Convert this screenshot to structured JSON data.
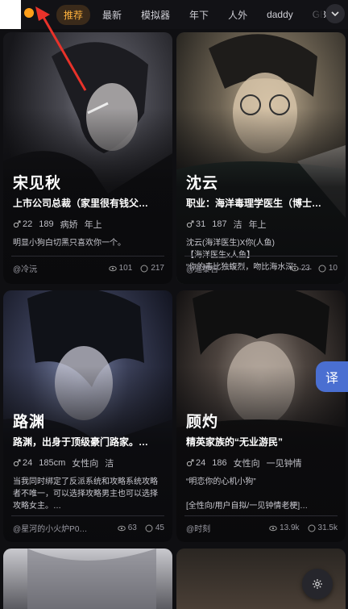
{
  "tabs": [
    {
      "label": "推荐",
      "active": true
    },
    {
      "label": "最新",
      "active": false
    },
    {
      "label": "模拟器",
      "active": false
    },
    {
      "label": "年下",
      "active": false
    },
    {
      "label": "人外",
      "active": false
    },
    {
      "label": "daddy",
      "active": false
    },
    {
      "label": "GB",
      "active": false
    }
  ],
  "cards": [
    {
      "name": "宋见秋",
      "subtitle": "上市公司总裁（家里很有钱父…",
      "tags": [
        "22",
        "189",
        "病娇",
        "年上"
      ],
      "desc": "明显小狗白切黑只喜欢你一个。",
      "author": "@冷沅",
      "views": "101",
      "comments": "217"
    },
    {
      "name": "沈云",
      "subtitle": "职业：海洋毒理学医生（博士…",
      "tags": [
        "31",
        "187",
        "洁",
        "年上"
      ],
      "desc": "沈云(海洋医生)X你(人鱼)\n【海洋医生x人鱼】\n“你的毒比独蝮烈，吻比海水深”……",
      "author": "@遥黎吉",
      "views": "23",
      "comments": "10"
    },
    {
      "name": "路渊",
      "subtitle": "路渊，出身于顶级豪门路家。…",
      "tags": [
        "24",
        "185cm",
        "女性向",
        "洁"
      ],
      "desc": "当我同时绑定了反派系统和攻略系统攻略者不唯一，可以选择攻略男主也可以选择攻略女主。…",
      "author": "@星河的小火炉P0…",
      "views": "63",
      "comments": "45"
    },
    {
      "name": "顾灼",
      "subtitle": "精英家族的“无业游民”",
      "tags": [
        "24",
        "186",
        "女性向",
        "一见钟情"
      ],
      "desc": "“明恋你的心机小狗”\n\n[全性向/用户自拟/一见钟情老梗]…",
      "author": "@时刻",
      "views": "13.9k",
      "comments": "31.5k"
    }
  ],
  "translate_label": "译",
  "icons": {
    "more": "chevron-down-icon",
    "gender": "male-icon",
    "views": "eye-icon",
    "comments": "comment-icon",
    "settings": "settings-icon"
  },
  "colors": {
    "accent": "#ffb23d",
    "translate_bg": "#4a6fd1",
    "arrow": "#e8322a"
  }
}
